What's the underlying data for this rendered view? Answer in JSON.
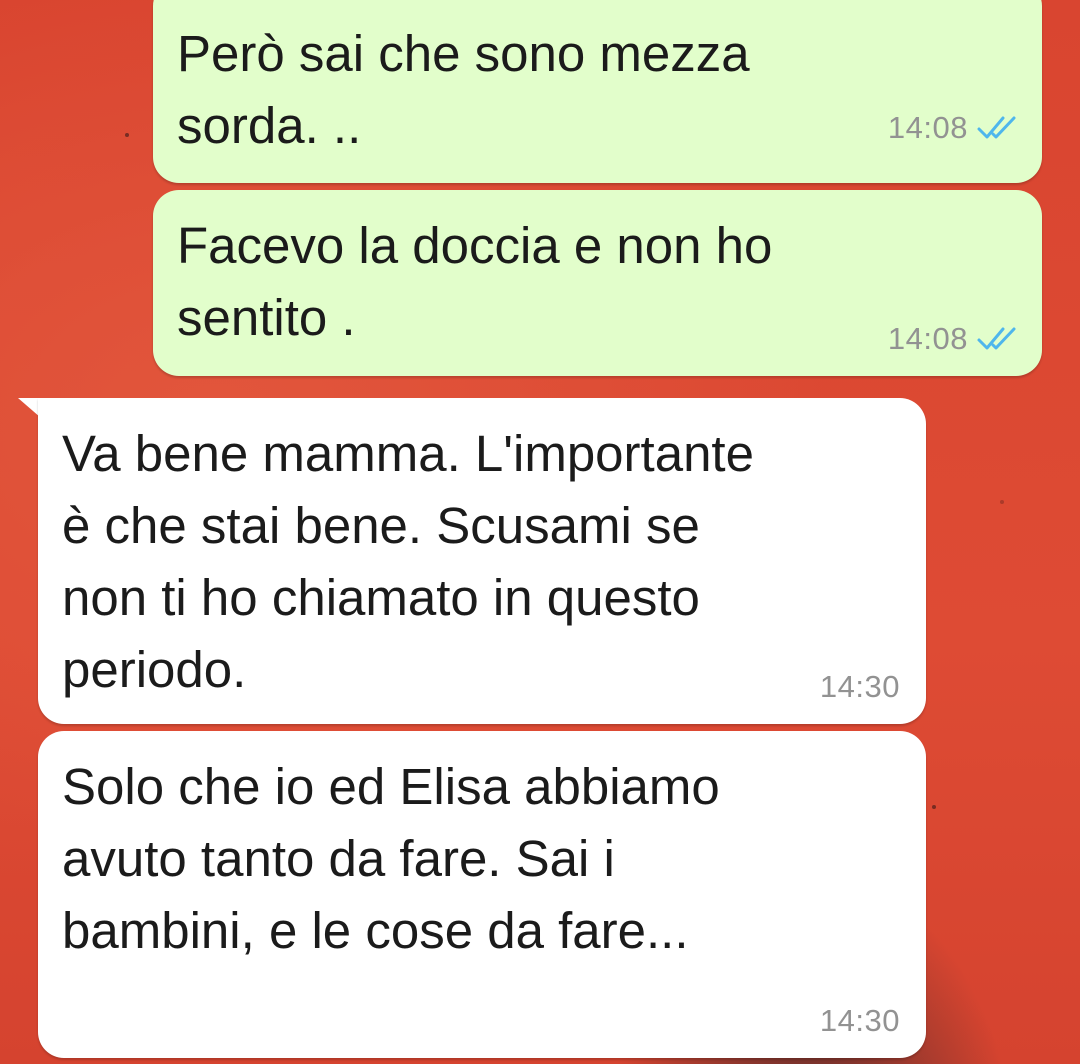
{
  "chat": {
    "messages": [
      {
        "direction": "outgoing",
        "text": "Però sai che sono mezza\nsorda. ..",
        "time": "14:08",
        "status": "read"
      },
      {
        "direction": "outgoing",
        "text": "Facevo la doccia e non ho\nsentito .",
        "time": "14:08",
        "status": "read"
      },
      {
        "direction": "incoming",
        "text": "Va bene mamma. L'importante\nè che stai bene. Scusami se\nnon ti ho chiamato in questo\nperiodo.",
        "time": "14:30"
      },
      {
        "direction": "incoming",
        "text": "Solo che io ed Elisa abbiamo\navuto tanto da fare. Sai i\nbambini, e le cose da fare...",
        "time": "14:30"
      }
    ]
  },
  "colors": {
    "outgoing_bubble": "#e2fecb",
    "incoming_bubble": "#ffffff",
    "read_ticks": "#4fb6ec",
    "wallpaper": "#dd4a33"
  },
  "icons": {
    "read_status": "double-check-icon"
  }
}
